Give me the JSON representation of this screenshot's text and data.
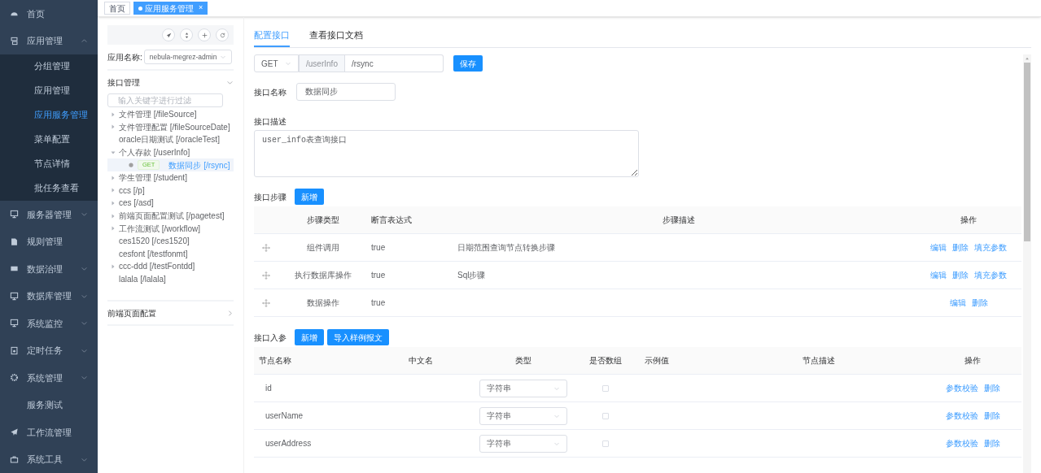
{
  "sidebar": {
    "items": [
      {
        "label": "首页",
        "kind": "link",
        "selected": false
      },
      {
        "label": "应用管理",
        "kind": "group",
        "selected": false,
        "expanded": true,
        "children": [
          {
            "label": "分组管理",
            "selected": false
          },
          {
            "label": "应用管理",
            "selected": false
          },
          {
            "label": "应用服务管理",
            "selected": true
          },
          {
            "label": "菜单配置",
            "selected": false
          },
          {
            "label": "节点详情",
            "selected": false
          },
          {
            "label": "批任务查看",
            "selected": false
          }
        ]
      },
      {
        "label": "服务器管理",
        "kind": "group",
        "selected": false,
        "expanded": false
      },
      {
        "label": "规则管理",
        "kind": "link",
        "selected": false
      },
      {
        "label": "数据治理",
        "kind": "group",
        "selected": false,
        "expanded": false
      },
      {
        "label": "数据库管理",
        "kind": "group",
        "selected": false,
        "expanded": false
      },
      {
        "label": "系统监控",
        "kind": "group",
        "selected": false,
        "expanded": false
      },
      {
        "label": "定时任务",
        "kind": "group",
        "selected": false,
        "expanded": false
      },
      {
        "label": "系统管理",
        "kind": "group",
        "selected": false,
        "expanded": false
      },
      {
        "label": "服务测试",
        "kind": "plain",
        "selected": false
      },
      {
        "label": "工作流管理",
        "kind": "link",
        "selected": false
      },
      {
        "label": "系统工具",
        "kind": "group",
        "selected": false,
        "expanded": false
      }
    ]
  },
  "page_tabs": [
    {
      "label": "首页",
      "selected": false
    },
    {
      "label": "应用服务管理",
      "selected": true,
      "close": "×"
    }
  ],
  "tree_panel": {
    "app_label": "应用名称:",
    "app_value": "nebula-megrez-admin",
    "sections": [
      {
        "title": "接口管理",
        "expanded": true
      },
      {
        "title": "前端页面配置",
        "expanded": false
      }
    ],
    "filter_placeholder": "输入关键字进行过滤",
    "nodes": [
      {
        "label": "文件管理 [/fileSource]",
        "expanded": false
      },
      {
        "label": "文件管理配置 [/fileSourceDate]",
        "expanded": false
      },
      {
        "label": "oracle日期测试 [/oracleTest]"
      },
      {
        "label": "个人存款 [/userInfo]",
        "expanded": true,
        "children": [
          {
            "method": "GET",
            "label": "数据同步 [/rsync]",
            "selected": true
          }
        ]
      },
      {
        "label": "学生管理 [/student]",
        "expanded": false
      },
      {
        "label": "ccs [/p]",
        "expanded": false
      },
      {
        "label": "ces [/asd]",
        "expanded": false
      },
      {
        "label": "前端页面配置测试 [/pagetest]",
        "expanded": false
      },
      {
        "label": "工作流测试 [/workflow]",
        "expanded": false
      },
      {
        "label": "ces1520 [/ces1520]"
      },
      {
        "label": "cesfont [/testfonmt]"
      },
      {
        "label": "ccc-ddd [/testFontdd]",
        "expanded": false
      },
      {
        "label": "lalala [/lalala]"
      }
    ]
  },
  "main": {
    "tabs": [
      {
        "label": "配置接口",
        "selected": true
      },
      {
        "label": "查看接口文档",
        "selected": false
      }
    ],
    "method": "GET",
    "base_path": "/userInfo",
    "path": "/rsync",
    "save": "保存",
    "name_label": "接口名称",
    "name_value": "数据同步",
    "desc_label": "接口描述",
    "desc_value": "user_info表查询接口",
    "steps": {
      "title": "接口步骤",
      "add": "新增",
      "columns": [
        "步骤类型",
        "断言表达式",
        "步骤描述",
        "操作"
      ],
      "rows": [
        {
          "type": "组件调用",
          "assertion": "true",
          "description": "日期范围查询节点转换步骤",
          "actions": [
            "编辑",
            "删除",
            "填充参数"
          ]
        },
        {
          "type": "执行数据库操作",
          "assertion": "true",
          "description": "Sql步骤",
          "actions": [
            "编辑",
            "删除",
            "填充参数"
          ]
        },
        {
          "type": "数据操作",
          "assertion": "true",
          "actions": [
            "编辑",
            "删除"
          ]
        }
      ]
    },
    "params": {
      "title": "接口入参",
      "add": "新增",
      "import": "导入样例报文",
      "columns": [
        "节点名称",
        "中文名",
        "类型",
        "是否数组",
        "示例值",
        "节点描述",
        "操作"
      ],
      "rows": [
        {
          "name": "id",
          "type": "字符串",
          "is_array": false,
          "actions": [
            "参数校验",
            "删除"
          ]
        },
        {
          "name": "userName",
          "type": "字符串",
          "is_array": false,
          "actions": [
            "参数校验",
            "删除"
          ]
        },
        {
          "name": "userAddress",
          "type": "字符串",
          "is_array": false,
          "actions": [
            "参数校验",
            "删除"
          ]
        }
      ]
    }
  }
}
